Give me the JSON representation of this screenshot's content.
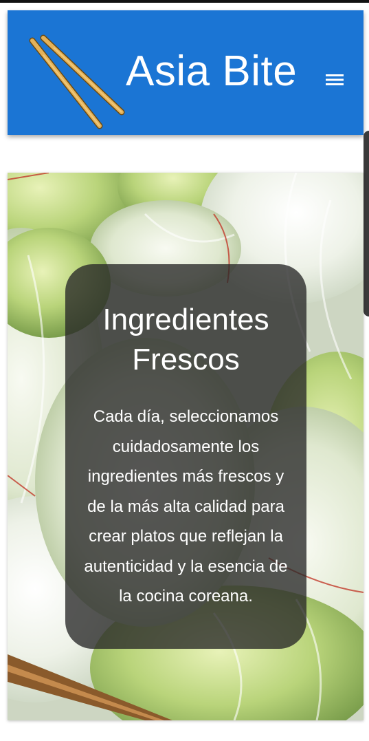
{
  "header": {
    "brand": "Asia Bite",
    "logo_icon": "chopsticks-icon",
    "menu_icon": "hamburger-menu-icon",
    "background_color": "#1b75d4"
  },
  "hero": {
    "background_image": "napa-cabbage-photo",
    "title": "Ingredientes\nFrescos",
    "text": "Cada día, seleccionamos cuidadosamente los ingredientes más frescos y de la más alta calidad para crear platos que reflejan la autenticidad y la esencia de la cocina coreana."
  }
}
